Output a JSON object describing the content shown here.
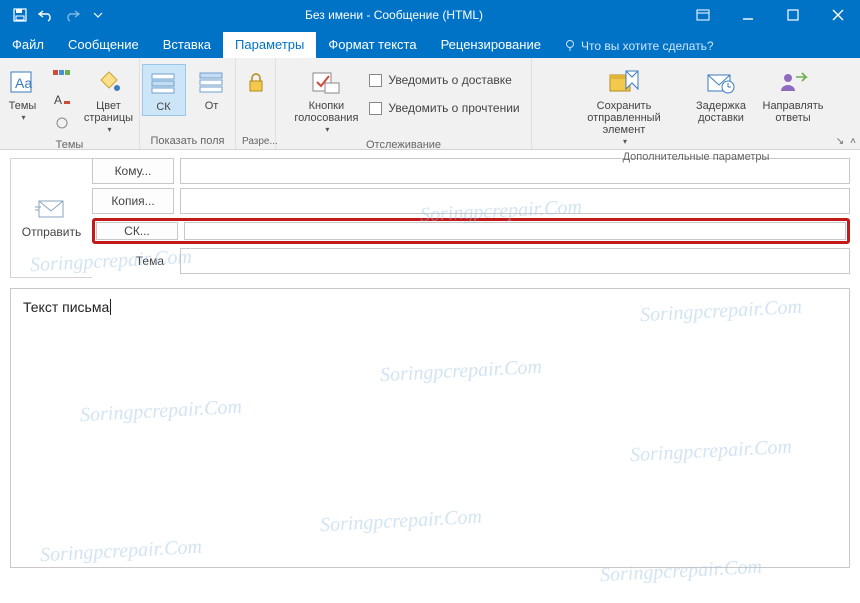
{
  "titlebar": {
    "title": "Без имени - Сообщение (HTML)"
  },
  "tabs": {
    "file": "Файл",
    "message": "Сообщение",
    "insert": "Вставка",
    "options": "Параметры",
    "format": "Формат текста",
    "review": "Рецензирование",
    "tell_me": "Что вы хотите сделать?"
  },
  "ribbon": {
    "themes": {
      "themes_btn": "Темы",
      "color_btn": "Цвет страницы",
      "group_label": "Темы"
    },
    "show_fields": {
      "bcc_btn": "СК",
      "from_btn": "От",
      "group_label": "Показать поля"
    },
    "permissions": {
      "group_label": "Разре..."
    },
    "tracking": {
      "voting_btn": "Кнопки голосования",
      "delivery_chk": "Уведомить о доставке",
      "read_chk": "Уведомить о прочтении",
      "group_label": "Отслеживание"
    },
    "more": {
      "save_sent_btn": "Сохранить отправленный элемент",
      "delay_btn": "Задержка доставки",
      "direct_replies_btn": "Направлять ответы",
      "group_label": "Дополнительные параметры"
    }
  },
  "compose": {
    "send": "Отправить",
    "to_btn": "Кому...",
    "cc_btn": "Копия...",
    "bcc_btn": "СК...",
    "subject_label": "Тема",
    "to_val": "",
    "cc_val": "",
    "bcc_val": "",
    "subject_val": ""
  },
  "body": {
    "text": "Текст письма"
  },
  "watermark": "Soringpcrepair.Com"
}
